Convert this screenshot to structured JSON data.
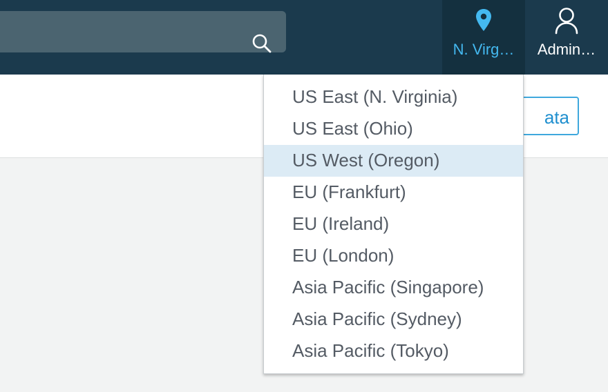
{
  "header": {
    "search": {
      "placeholder": ""
    },
    "region_button": {
      "label": "N. Virg…"
    },
    "account_button": {
      "label": "Admin…"
    }
  },
  "panel": {
    "button_label": "ata"
  },
  "region_dropdown": {
    "highlighted_index": 2,
    "items": [
      "US East (N. Virginia)",
      "US East (Ohio)",
      "US West (Oregon)",
      "EU (Frankfurt)",
      "EU (Ireland)",
      "EU (London)",
      "Asia Pacific (Singapore)",
      "Asia Pacific (Sydney)",
      "Asia Pacific (Tokyo)"
    ]
  },
  "colors": {
    "topbar": "#1b3a4d",
    "region_button_bg": "#14303f",
    "accent": "#44b9f0",
    "highlight": "#dcebf5",
    "menu_text": "#545b64"
  },
  "icons": [
    "search-icon",
    "location-pin-icon",
    "user-icon"
  ]
}
